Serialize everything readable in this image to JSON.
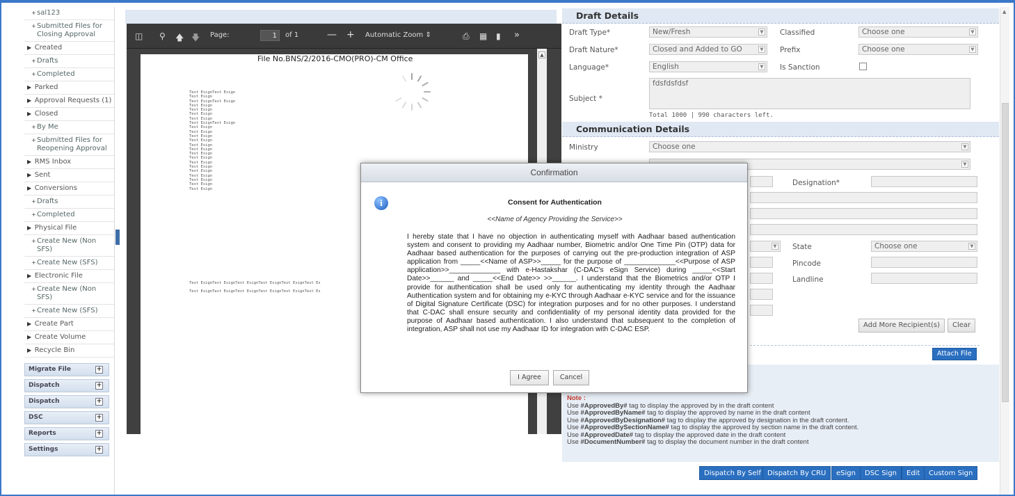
{
  "sidebar": {
    "items": [
      {
        "label": "sal123",
        "level": 2
      },
      {
        "label": "Submitted Files for Closing Approval",
        "level": 2
      },
      {
        "label": "Created",
        "level": 1
      },
      {
        "label": "Drafts",
        "level": 2
      },
      {
        "label": "Completed",
        "level": 2
      },
      {
        "label": "Parked",
        "level": 1
      },
      {
        "label": "Approval Requests (1)",
        "level": 1
      },
      {
        "label": "Closed",
        "level": 1
      },
      {
        "label": "By Me",
        "level": 2
      },
      {
        "label": "Submitted Files for Reopening Approval",
        "level": 2
      },
      {
        "label": "RMS Inbox",
        "level": 1
      },
      {
        "label": "Sent",
        "level": 1
      },
      {
        "label": "Conversions",
        "level": 1
      },
      {
        "label": "Drafts",
        "level": 2
      },
      {
        "label": "Completed",
        "level": 2
      },
      {
        "label": "Physical File",
        "level": 1
      },
      {
        "label": "Create New (Non SFS)",
        "level": 2
      },
      {
        "label": "Create New (SFS)",
        "level": 2
      },
      {
        "label": "Electronic File",
        "level": 1
      },
      {
        "label": "Create New (Non SFS)",
        "level": 2
      },
      {
        "label": "Create New (SFS)",
        "level": 2
      },
      {
        "label": "Create Part",
        "level": 1
      },
      {
        "label": "Create Volume",
        "level": 1
      },
      {
        "label": "Recycle Bin",
        "level": 1
      }
    ],
    "accordions": [
      "Migrate File",
      "Dispatch",
      "Dispatch",
      "DSC",
      "Reports",
      "Settings"
    ]
  },
  "pdf_viewer": {
    "page_label": "Page:",
    "page_value": "1",
    "page_of": "of 1",
    "zoom": "Automatic Zoom",
    "file_title": "File No.BNS/2/2016-CMO(PRO)-CM Office",
    "esign_lines": [
      "Test EsignTest Esign",
      "Test Esign",
      "Test EsignTest Esign",
      "Test Esign",
      "Test Esign",
      "Test Esign",
      "Test Esign",
      "Test EsignTest Esign",
      "Test Esign",
      "Test Esign",
      "Test Esign",
      "Test Esign",
      "Test Esign",
      "Test Esign",
      "Test Esign",
      "Test Esign",
      "Test Esign",
      "Test Esign",
      "Test Esign",
      "Test Esign",
      "Test Esign",
      "Test Esign",
      "Test Esign"
    ],
    "esign_long": "Test EsignTest EsignTest EsignTest EsignTest EsignTest Es",
    "esign_long2": "Test EsignTest EsignTest EsignTest EsignTest EsignTest Es"
  },
  "draft_details": {
    "heading": "Draft Details",
    "draft_type_label": "Draft Type*",
    "draft_type_value": "New/Fresh",
    "classified_label": "Classified",
    "classified_value": "Choose one",
    "draft_nature_label": "Draft Nature*",
    "draft_nature_value": "Closed and Added to GO",
    "prefix_label": "Prefix",
    "prefix_value": "Choose one",
    "language_label": "Language*",
    "language_value": "English",
    "is_sanction_label": "Is Sanction",
    "subject_label": "Subject *",
    "subject_value": "fdsfdsfdsf",
    "char_count": "Total 1000 |  990   characters left."
  },
  "communication": {
    "heading": "Communication Details",
    "ministry_label": "Ministry",
    "ministry_value": "Choose one",
    "designation_label": "Designation*",
    "state_label": "State",
    "state_value": "Choose one",
    "pincode_label": "Pincode",
    "landline_label": "Landline",
    "add_more": "Add More Recipient(s)",
    "clear": "Clear",
    "attach": "Attach File"
  },
  "notes": {
    "heading": "Note :",
    "lines": [
      {
        "pre": "Use ",
        "tag": "#ApprovedBy#",
        "post": " tag to display the approved by in the draft content"
      },
      {
        "pre": "Use ",
        "tag": "#ApprovedByName#",
        "post": " tag to display the approved by name in the draft content"
      },
      {
        "pre": "Use ",
        "tag": "#ApprovedByDesignation#",
        "post": " tag to display the approved by designation in the draft content."
      },
      {
        "pre": "Use ",
        "tag": "#ApprovedBySectionName#",
        "post": " tag to display the approved by section name in the draft content."
      },
      {
        "pre": "Use ",
        "tag": "#ApprovedDate#",
        "post": " tag to display the approved date in the draft content"
      },
      {
        "pre": "Use ",
        "tag": "#DocumentNumber#",
        "post": " tag to display the document number in the draft content"
      }
    ]
  },
  "actions": [
    "Dispatch By Self",
    "Dispatch By CRU",
    "eSign",
    "DSC Sign",
    "Edit",
    "Custom Sign"
  ],
  "dialog": {
    "title": "Confirmation",
    "heading": "Consent for Authentication",
    "subheading": "<<Name of Agency Providing the Service>>",
    "body": "I hereby state that I have no objection in authenticating myself with Aadhaar based authentication system and consent to providing my Aadhaar number, Biometric and/or One Time Pin (OTP) data for Aadhaar based authentication for the purposes of carrying out the pre-production integration of ASP application from _____<<Name of ASP>>_____ for the purpose of _____________<<Purpose of ASP application>>_____________ with e-Hastakshar (C-DAC's eSign Service) during _____<<Start Date>>______ and _____<<End Date>> >>______. I understand that the Biometrics and/or OTP I provide for authentication shall be used only for authenticating my identity through the Aadhaar Authentication system and for obtaining my e-KYC through Aadhaar e-KYC service and for the issuance of Digital Signature Certificate (DSC) for integration purposes and for no other purposes. I understand that C-DAC shall ensure security and confidentiality of my personal identity data provided for the purpose of Aadhaar based authentication. I also understand that subsequent to the completion of integration, ASP shall not use my Aadhaar ID for integration with C-DAC ESP.",
    "agree": "I Agree",
    "cancel": "Cancel"
  }
}
